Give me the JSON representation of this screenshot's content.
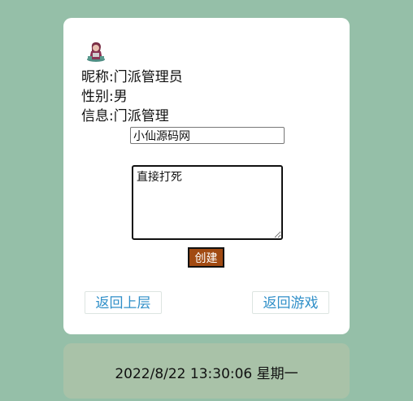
{
  "profile": {
    "nickname": "昵称:门派管理员",
    "gender": "性别:男",
    "info": "信息:门派管理",
    "avatar_icon": "character-sprite-icon"
  },
  "form": {
    "sect_name_value": "小仙源码网",
    "description_value": "直接打死",
    "create_label": "创建"
  },
  "nav": {
    "back_label": "返回上层",
    "game_label": "返回游戏"
  },
  "clock": {
    "datetime": "2022/8/22 13:30:06 星期一"
  },
  "colors": {
    "background": "#95bfa8",
    "card": "#ffffff",
    "create_button": "#a14a12",
    "link": "#2f8fc8",
    "clock_panel": "#a9c2a8"
  }
}
